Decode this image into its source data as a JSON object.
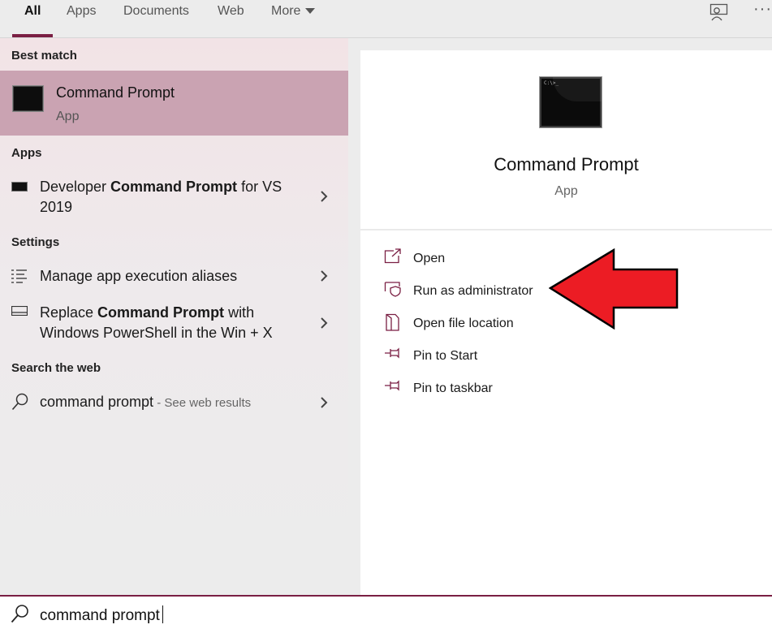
{
  "tabs": [
    {
      "label": "All"
    },
    {
      "label": "Apps"
    },
    {
      "label": "Documents"
    },
    {
      "label": "Web"
    },
    {
      "label": "More"
    }
  ],
  "left": {
    "best_match_header": "Best match",
    "best_match": {
      "title": "Command Prompt",
      "subtitle": "App"
    },
    "apps_header": "Apps",
    "apps_item": {
      "pre": "Developer ",
      "bold": "Command Prompt",
      "post": " for VS",
      "line2": "2019"
    },
    "settings_header": "Settings",
    "settings_items": [
      {
        "label": "Manage app execution aliases"
      },
      {
        "pre": "Replace ",
        "bold": "Command Prompt",
        "post": " with",
        "line2": "Windows PowerShell in the Win + X"
      }
    ],
    "web_header": "Search the web",
    "web_item": {
      "query": "command prompt",
      "hint": " - See web results"
    }
  },
  "right": {
    "title": "Command Prompt",
    "subtitle": "App",
    "actions": [
      {
        "label": "Open",
        "icon": "open-icon"
      },
      {
        "label": "Run as administrator",
        "icon": "shield-icon"
      },
      {
        "label": "Open file location",
        "icon": "file-location-icon"
      },
      {
        "label": "Pin to Start",
        "icon": "pin-icon"
      },
      {
        "label": "Pin to taskbar",
        "icon": "pin-icon"
      }
    ]
  },
  "search": {
    "value": "command prompt"
  },
  "colors": {
    "accent": "#7a1f43",
    "highlight": "#caa3b2",
    "arrow": "#ec1c24"
  }
}
